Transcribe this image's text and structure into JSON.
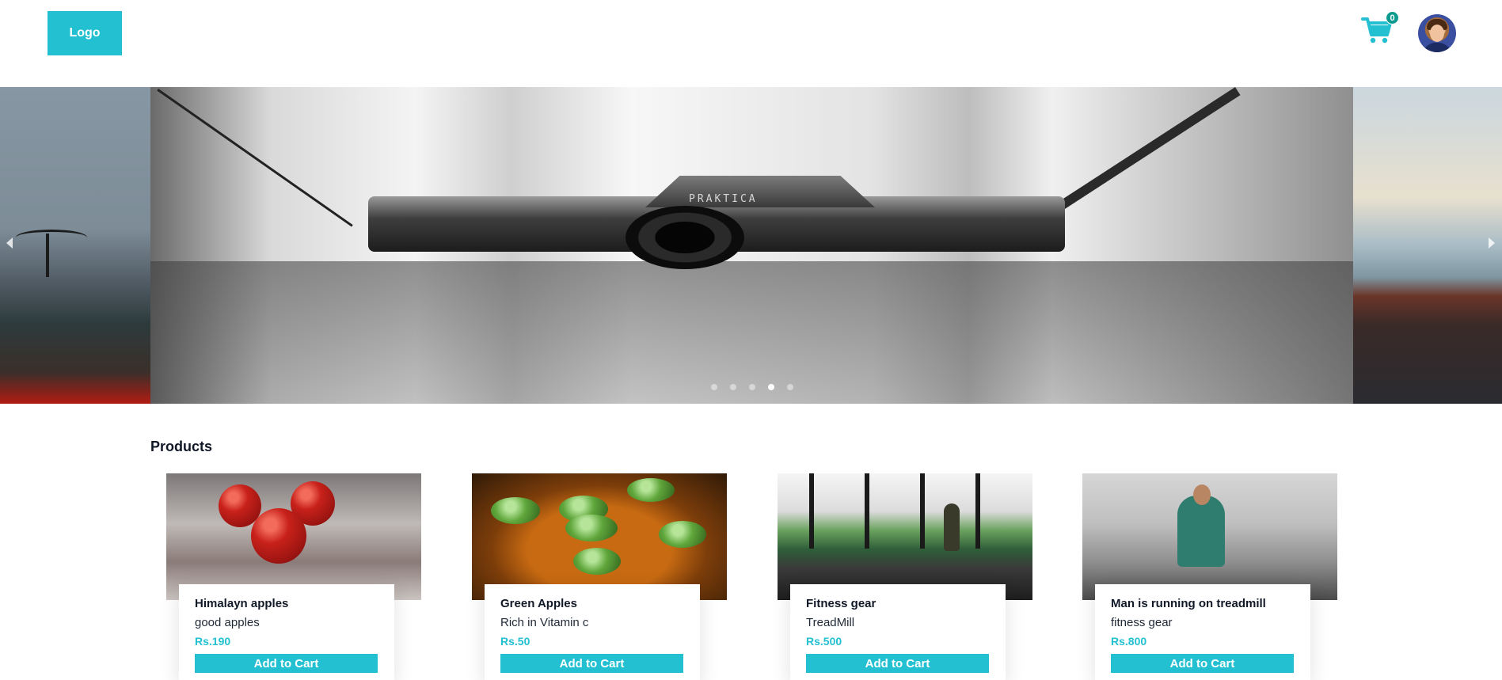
{
  "header": {
    "logo_label": "Logo",
    "cart_count": "0",
    "cart_icon": "cart-icon",
    "avatar_icon": "user-avatar"
  },
  "carousel": {
    "slides_count": 5,
    "active_slide": 4,
    "prev_icon": "chevron-left-icon",
    "next_icon": "chevron-right-icon",
    "main_slide_text": "PRAKTICA"
  },
  "products": {
    "title": "Products",
    "items": [
      {
        "title": "Himalayn apples",
        "description": "good apples",
        "price": "Rs.190",
        "button": "Add to Cart"
      },
      {
        "title": "Green Apples",
        "description": "Rich in Vitamin c",
        "price": "Rs.50",
        "button": "Add to Cart"
      },
      {
        "title": "Fitness gear",
        "description": "TreadMill",
        "price": "Rs.500",
        "button": "Add to Cart"
      },
      {
        "title": "Man is running on treadmill",
        "description": "fitness gear",
        "price": "Rs.800",
        "button": "Add to Cart"
      }
    ]
  },
  "colors": {
    "accent": "#22c0d1",
    "badge": "#0e9b8f"
  }
}
